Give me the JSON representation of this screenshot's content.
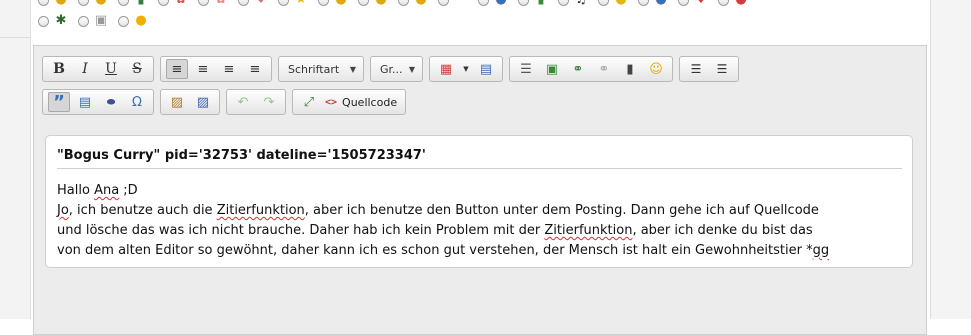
{
  "smilies": {
    "row1": [
      "smiley-icon",
      "wink-icon",
      "drink-icon",
      "flower-icon",
      "rose-icon",
      "heart-icon",
      "star-icon",
      "happy-icon",
      "grin-icon",
      "surprised-icon",
      "rainbow-icon",
      "globe-icon",
      "photo-icon",
      "music-icon",
      "lightbulb-icon",
      "help-icon",
      "heart-broken-icon",
      "warning-icon"
    ],
    "row2": [
      "bug-icon",
      "cube-icon",
      "cheeky-icon"
    ]
  },
  "toolbar": {
    "bold_label": "B",
    "italic_label": "I",
    "underline_label": "U",
    "strike_label": "S",
    "font_combo": "Schriftart",
    "size_combo": "Gr...",
    "source_label": "Quellcode"
  },
  "content": {
    "quote_header": "\"Bogus Curry\" pid='32753' dateline='1505723347'",
    "greeting_pre": "Hallo ",
    "greeting_name": "Ana",
    "greeting_post": " ;D",
    "l1a": "Jo",
    "l1b": ", ich benutze auch die ",
    "l1c": "Zitierfunktion",
    "l1d": ", aber ich benutze den Button unter dem Posting. Dann gehe ich auf Quellcode",
    "l2": "und lösche das was ich nicht brauche. Daher hab ich kein Problem mit der ",
    "l2b": "Zitierfunktion",
    "l2c": ", aber ich denke du bist das",
    "l3a": "von dem alten Editor so gewöhnt, daher kann ich es schon gut verstehen, der Mensch ist halt ein Gewohnheitstier *",
    "l3b": "gg"
  }
}
